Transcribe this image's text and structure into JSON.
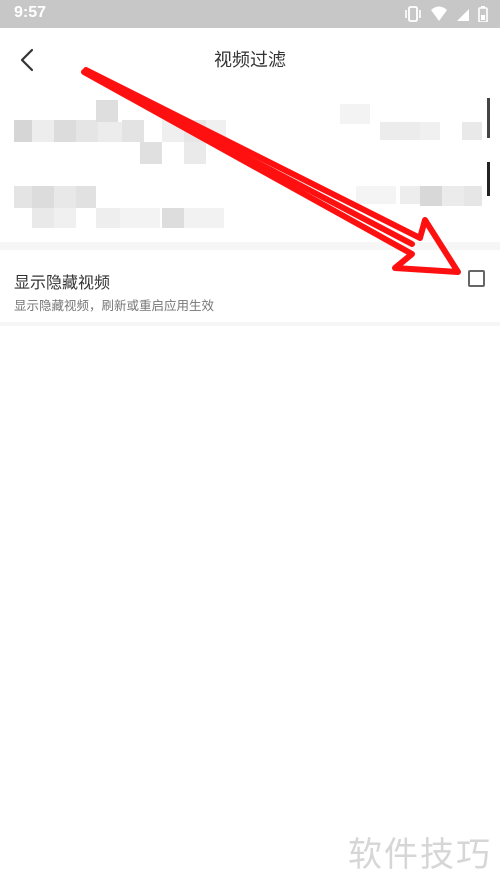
{
  "status_bar": {
    "time": "9:57",
    "icons": [
      "vibrate-icon",
      "wifi-icon",
      "signal-icon",
      "battery-icon"
    ]
  },
  "header": {
    "title": "视频过滤",
    "back_icon": "chevron-left-icon"
  },
  "filter_list": {
    "content": "pixelated-redacted"
  },
  "setting": {
    "title": "显示隐藏视频",
    "description": "显示隐藏视频，刷新或重启应用生效",
    "checked": false
  },
  "annotation": {
    "type": "red-arrow",
    "color": "#ff1010"
  },
  "watermark": {
    "text": "软件技巧"
  },
  "colors": {
    "status_bar": "#c7c7c7",
    "background": "#ffffff",
    "section_gap": "#f6f6f6",
    "arrow": "#ff1010"
  }
}
